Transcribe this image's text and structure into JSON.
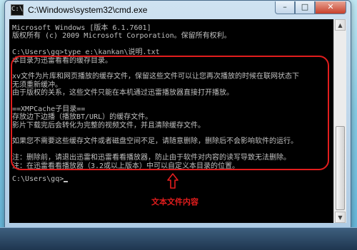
{
  "window": {
    "title": "C:\\Windows\\system32\\cmd.exe",
    "app_icon_glyph": "C:\\",
    "buttons": {
      "minimize": "–",
      "maximize": "□",
      "close": "✕"
    }
  },
  "console": {
    "lines": [
      "Microsoft Windows [版本 6.1.7601]",
      "版权所有 (c) 2009 Microsoft Corporation。保留所有权利。",
      "",
      "C:\\Users\\gq>type e:\\kankan\\说明.txt",
      "本目录为迅雷看看的缓存目录。",
      "",
      "xv文件为片库和网页播放的缓存文件，保留这些文件可以让您再次播放的时候在联网状态下",
      "无须重新缓冲。",
      "由于版权的关系，这些文件只能在本机通过迅雷播放器直接打开播放。",
      "",
      "==XMPCache子目录==",
      "存放边下边播（播放BT/URL）的缓存文件。",
      "影片下载完后会转化为完整的视频文件，并且清除缓存文件。",
      "",
      "如果您不需要这些缓存文件或者磁盘空间不足，请随意删除，删除后不会影响软件的运行。",
      "",
      "注：删除前，请退出迅雷和迅雷看看播放器，防止由于软件对内容的读写导致无法删除。",
      "注：在迅雷看看播放器（3.2或以上版本）中可以自定义本目录的位置。",
      "",
      "C:\\Users\\gq>"
    ],
    "colors": {
      "background": "#000000",
      "text": "#c0c0c0"
    }
  },
  "scrollbar": {
    "up_glyph": "▲",
    "down_glyph": "▼"
  },
  "annotation": {
    "label": "文本文件内容",
    "color": "#e21d1d"
  }
}
